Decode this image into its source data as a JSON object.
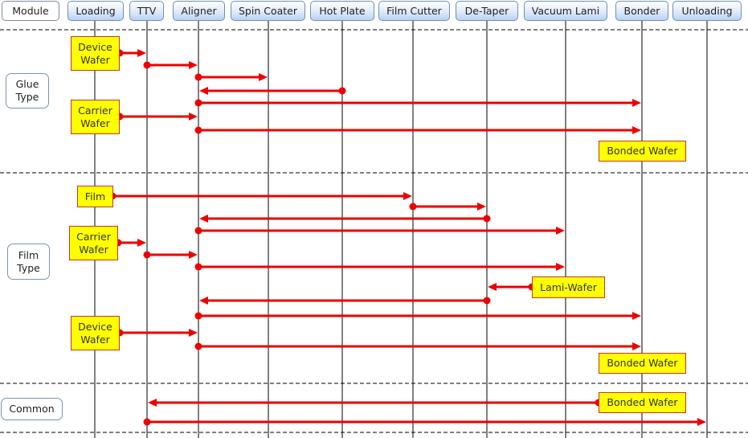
{
  "header": {
    "module_label": "Module",
    "lanes": [
      {
        "key": "loading",
        "label": "Loading"
      },
      {
        "key": "ttv",
        "label": "TTV"
      },
      {
        "key": "aligner",
        "label": "Aligner"
      },
      {
        "key": "spin_coater",
        "label": "Spin Coater"
      },
      {
        "key": "hot_plate",
        "label": "Hot Plate"
      },
      {
        "key": "film_cutter",
        "label": "Film  Cutter"
      },
      {
        "key": "de_taper",
        "label": "De-Taper"
      },
      {
        "key": "vacuum_lami",
        "label": "Vacuum Lami"
      },
      {
        "key": "bonder",
        "label": "Bonder"
      },
      {
        "key": "unloading",
        "label": "Unloading"
      }
    ]
  },
  "groups": [
    {
      "key": "glue",
      "label": "Glue\nType"
    },
    {
      "key": "film",
      "label": "Film\nType"
    },
    {
      "key": "common",
      "label": "Common"
    }
  ],
  "items": [
    {
      "key": "glue_device_wafer",
      "label": "Device\nWafer"
    },
    {
      "key": "glue_carrier_wafer",
      "label": "Carrier\nWafer"
    },
    {
      "key": "glue_bonded_wafer",
      "label": "Bonded Wafer"
    },
    {
      "key": "film_film",
      "label": "Film"
    },
    {
      "key": "film_carrier_wafer",
      "label": "Carrier\nWafer"
    },
    {
      "key": "film_lami_wafer",
      "label": "Lami-Wafer"
    },
    {
      "key": "film_device_wafer",
      "label": "Device\nWafer"
    },
    {
      "key": "film_bonded_wafer",
      "label": "Bonded Wafer"
    },
    {
      "key": "common_bonded_wafer",
      "label": "Bonded Wafer"
    }
  ],
  "flows": [
    {
      "group": "glue",
      "from": "glue_device_wafer",
      "to": "ttv"
    },
    {
      "group": "glue",
      "from": "ttv",
      "to": "aligner"
    },
    {
      "group": "glue",
      "from": "aligner",
      "to": "spin_coater"
    },
    {
      "group": "glue",
      "from": "hot_plate",
      "to": "aligner"
    },
    {
      "group": "glue",
      "from": "aligner",
      "to": "bonder"
    },
    {
      "group": "glue",
      "from": "glue_carrier_wafer",
      "to": "aligner"
    },
    {
      "group": "glue",
      "from": "aligner",
      "to": "bonder"
    },
    {
      "group": "film",
      "from": "film_film",
      "to": "film_cutter"
    },
    {
      "group": "film",
      "from": "film_cutter",
      "to": "de_taper"
    },
    {
      "group": "film",
      "from": "de_taper",
      "to": "aligner"
    },
    {
      "group": "film",
      "from": "aligner",
      "to": "vacuum_lami"
    },
    {
      "group": "film",
      "from": "film_carrier_wafer",
      "to": "ttv"
    },
    {
      "group": "film",
      "from": "ttv",
      "to": "aligner"
    },
    {
      "group": "film",
      "from": "aligner",
      "to": "vacuum_lami"
    },
    {
      "group": "film",
      "from": "film_lami_wafer",
      "to": "de_taper"
    },
    {
      "group": "film",
      "from": "de_taper",
      "to": "aligner"
    },
    {
      "group": "film",
      "from": "aligner",
      "to": "bonder"
    },
    {
      "group": "film",
      "from": "film_device_wafer",
      "to": "aligner"
    },
    {
      "group": "film",
      "from": "aligner",
      "to": "bonder"
    },
    {
      "group": "common",
      "from": "common_bonded_wafer",
      "to": "ttv"
    },
    {
      "group": "common",
      "from": "ttv",
      "to": "unloading"
    }
  ],
  "colors": {
    "flow": "#ee0000",
    "item_fill": "#ffff00",
    "item_border": "#c0392b",
    "lifeline": "#000000"
  }
}
